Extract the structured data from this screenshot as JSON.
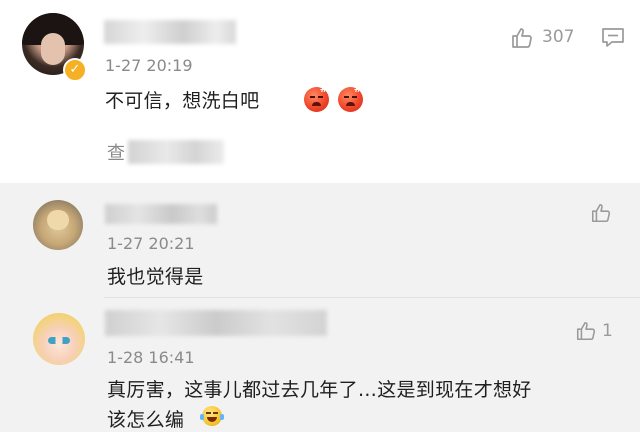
{
  "comments": {
    "main": {
      "time": "1-27 20:19",
      "text": "不可信，想洗白吧",
      "like_count": "307",
      "view_more_prefix": "查"
    },
    "reply1": {
      "time": "1-27 20:21",
      "text": "我也觉得是"
    },
    "reply2": {
      "time": "1-28 16:41",
      "like_count": "1",
      "text_line1": "真厉害，这事儿都过去几年了…这是到现在才想好",
      "text_line2": "该怎么编"
    }
  },
  "icons": {
    "like": "thumbs-up-icon",
    "comment": "comment-icon",
    "verified": "verified-badge-icon",
    "angry_emoji": "angry-face-icon",
    "laugh_emoji": "laugh-cry-icon"
  },
  "colors": {
    "verified_badge": "#f6b023",
    "reply_background": "#f2f2f2",
    "angry_emoji": "#f1462a",
    "icon_gray": "#9a9a9a"
  }
}
